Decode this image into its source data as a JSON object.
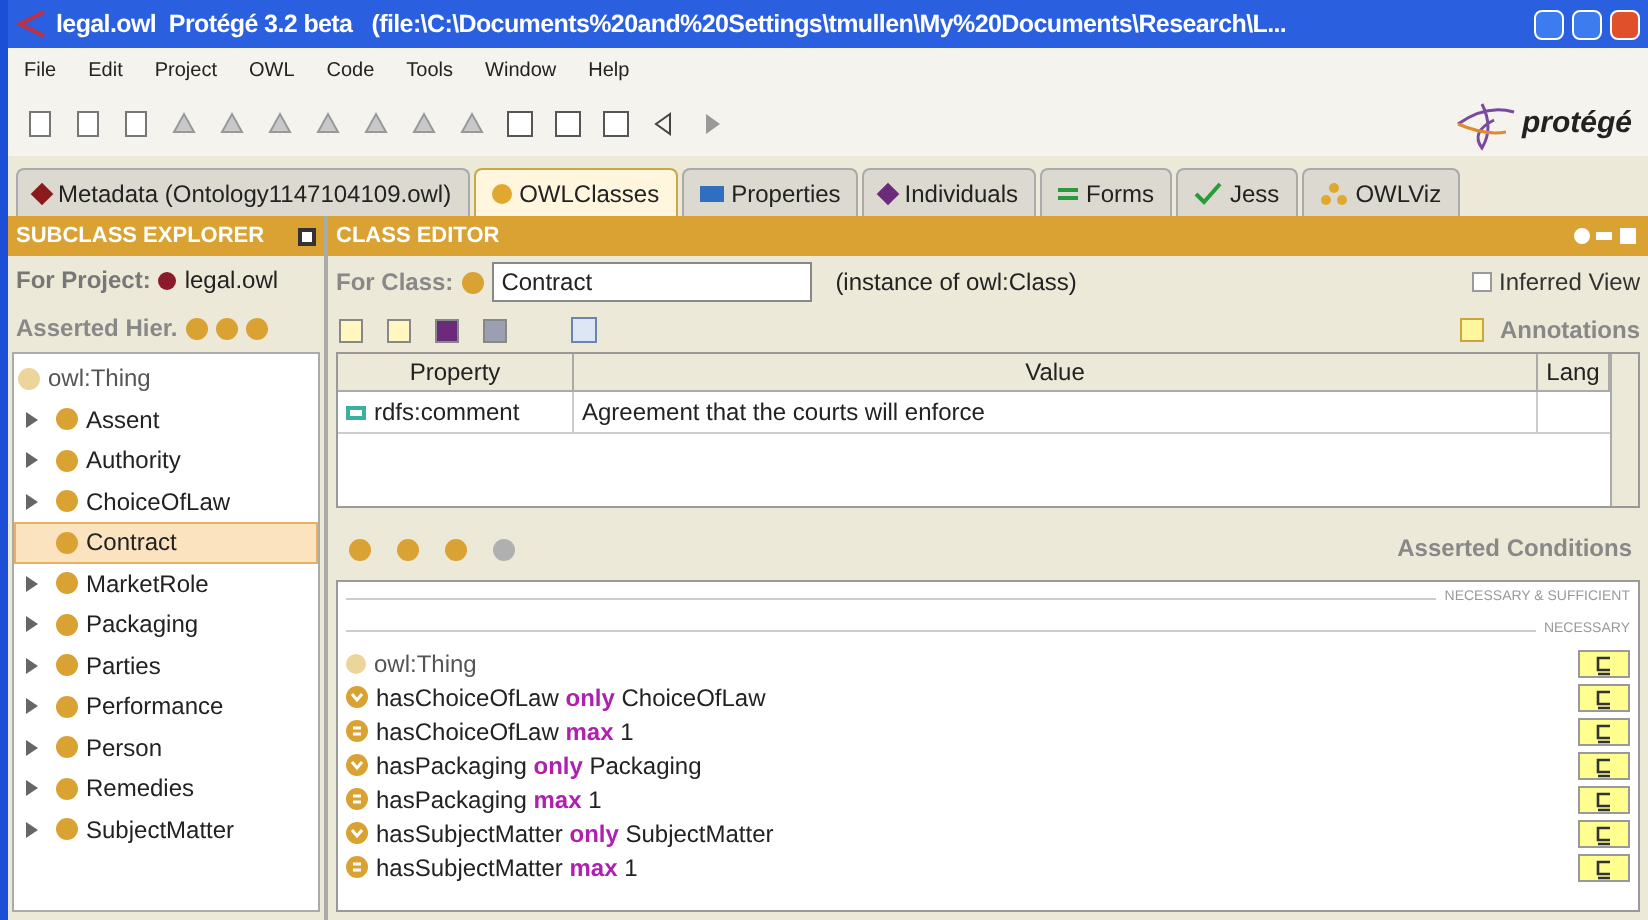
{
  "window": {
    "title": "legal.owl  Protégé 3.2 beta   (file:\\C:\\Documents%20and%20Settings\\tmullen\\My%20Documents\\Research\\L..."
  },
  "menu": [
    "File",
    "Edit",
    "Project",
    "OWL",
    "Code",
    "Tools",
    "Window",
    "Help"
  ],
  "logo": "protégé",
  "tabs": [
    {
      "label": "Metadata (Ontology1147104109.owl)",
      "selected": false,
      "kind": "metadata"
    },
    {
      "label": "OWLClasses",
      "selected": true,
      "kind": "classes"
    },
    {
      "label": "Properties",
      "selected": false,
      "kind": "properties"
    },
    {
      "label": "Individuals",
      "selected": false,
      "kind": "individuals"
    },
    {
      "label": "Forms",
      "selected": false,
      "kind": "forms"
    },
    {
      "label": "Jess",
      "selected": false,
      "kind": "jess"
    },
    {
      "label": "OWLViz",
      "selected": false,
      "kind": "owlviz"
    }
  ],
  "subclass_explorer": {
    "title": "SUBCLASS EXPLORER",
    "project_label": "For Project:",
    "project": "legal.owl",
    "hierarchy_label": "Asserted Hier.",
    "tree": [
      {
        "label": "owl:Thing",
        "selected": false,
        "children": [
          {
            "label": "Assent",
            "expandable": true,
            "selected": false
          },
          {
            "label": "Authority",
            "expandable": true,
            "selected": false
          },
          {
            "label": "ChoiceOfLaw",
            "expandable": true,
            "selected": false
          },
          {
            "label": "Contract",
            "expandable": false,
            "selected": true
          },
          {
            "label": "MarketRole",
            "expandable": true,
            "selected": false
          },
          {
            "label": "Packaging",
            "expandable": true,
            "selected": false
          },
          {
            "label": "Parties",
            "expandable": true,
            "selected": false
          },
          {
            "label": "Performance",
            "expandable": true,
            "selected": false
          },
          {
            "label": "Person",
            "expandable": true,
            "selected": false
          },
          {
            "label": "Remedies",
            "expandable": true,
            "selected": false
          },
          {
            "label": "SubjectMatter",
            "expandable": true,
            "selected": false
          }
        ]
      }
    ]
  },
  "class_editor": {
    "title": "CLASS EDITOR",
    "class_label": "For Class:",
    "class_value": "Contract",
    "instance_of": "(instance of owl:Class)",
    "inferred_view": {
      "label": "Inferred View",
      "checked": false
    },
    "annotations_label": "Annotations",
    "table": {
      "columns": [
        "Property",
        "Value",
        "Lang"
      ],
      "rows": [
        {
          "property": "rdfs:comment",
          "value": "Agreement that the courts will enforce"
        }
      ]
    },
    "conditions_label": "Asserted Conditions",
    "section_1": "NECESSARY & SUFFICIENT",
    "section_2": "NECESSARY",
    "conditions": [
      {
        "kind": "class",
        "property": "owl:Thing"
      },
      {
        "kind": "only",
        "property": "hasChoiceOfLaw",
        "keyword": "only",
        "filler": "ChoiceOfLaw"
      },
      {
        "kind": "max",
        "property": "hasChoiceOfLaw",
        "keyword": "max",
        "filler": "1"
      },
      {
        "kind": "only",
        "property": "hasPackaging",
        "keyword": "only",
        "filler": "Packaging"
      },
      {
        "kind": "max",
        "property": "hasPackaging",
        "keyword": "max",
        "filler": "1"
      },
      {
        "kind": "only",
        "property": "hasSubjectMatter",
        "keyword": "only",
        "filler": "SubjectMatter"
      },
      {
        "kind": "max",
        "property": "hasSubjectMatter",
        "keyword": "max",
        "filler": "1"
      }
    ]
  }
}
